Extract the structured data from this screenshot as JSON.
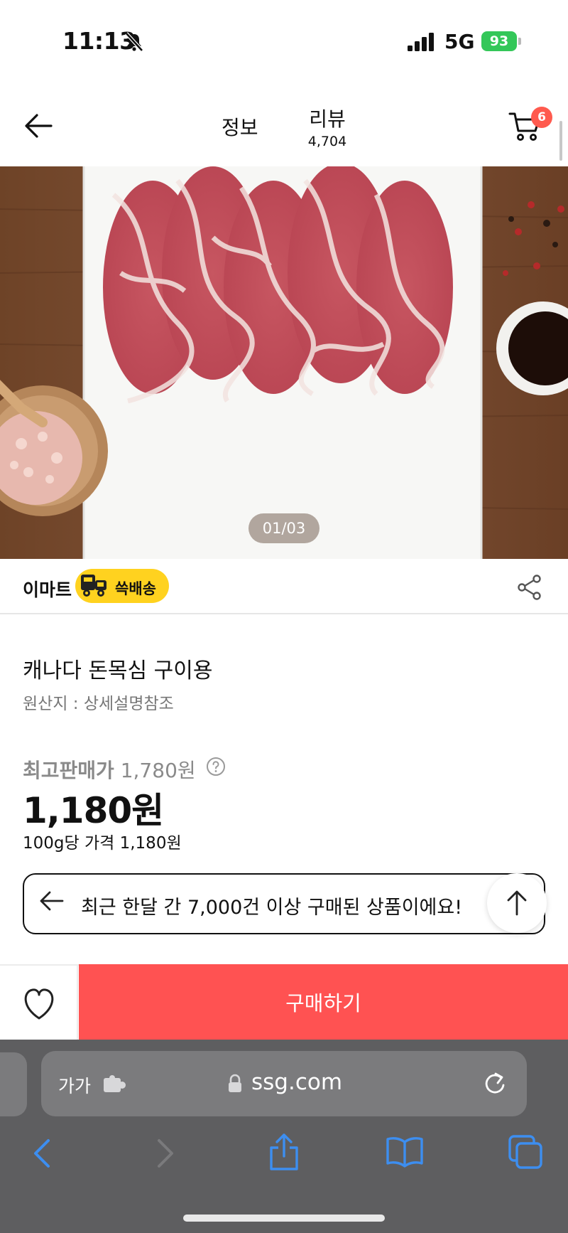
{
  "status_bar": {
    "time": "11:13",
    "network": "5G",
    "battery": "93"
  },
  "header": {
    "tab_info": "정보",
    "tab_review": "리뷰",
    "review_count": "4,704",
    "cart_count": "6"
  },
  "gallery": {
    "counter": "01/03"
  },
  "seller": {
    "name": "이마트",
    "delivery_badge": "쓱배송"
  },
  "product": {
    "title": "캐나다 돈목심 구이용",
    "origin": "원산지 : 상세설명참조",
    "max_price_label": "최고판매가",
    "max_price": "1,780원",
    "price": "1,180원",
    "unit_price": "100g당 가격 1,180원"
  },
  "notice": {
    "text": "최근 한달 간 7,000건 이상 구매된 상품이에요!"
  },
  "actions": {
    "buy_label": "구매하기"
  },
  "browser": {
    "text_size_label": "가가",
    "url": "ssg.com"
  },
  "colors": {
    "buy_button": "#ff5252",
    "cart_badge": "#ff5a4e",
    "delivery_badge": "#ffd21f",
    "battery": "#34c759",
    "browser_chrome": "#5e5e60",
    "browser_accent": "#3d8ef0"
  },
  "icons": [
    "bell-off-icon",
    "signal-icon",
    "back-arrow-icon",
    "cart-icon",
    "truck-icon",
    "share-icon",
    "help-icon",
    "arrow-left-icon",
    "arrow-up-icon",
    "heart-icon",
    "extension-icon",
    "lock-icon",
    "reload-icon",
    "chevron-left-icon",
    "chevron-right-icon",
    "share-sheet-icon",
    "book-icon",
    "tabs-icon"
  ]
}
